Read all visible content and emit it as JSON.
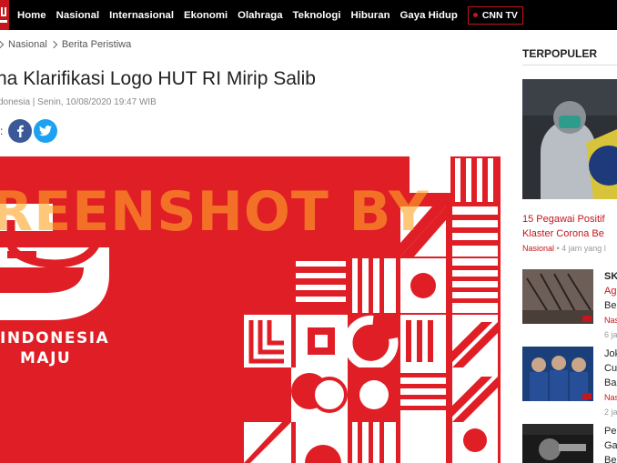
{
  "nav": {
    "items": [
      "Home",
      "Nasional",
      "Internasional",
      "Ekonomi",
      "Olahraga",
      "Teknologi",
      "Hiburan",
      "Gaya Hidup"
    ],
    "cnntv_label": "CNN TV"
  },
  "breadcrumb": {
    "items": [
      "Nasional",
      "Berita Peristiwa"
    ]
  },
  "article": {
    "title": "na Klarifikasi Logo HUT RI Mirip Salib",
    "meta": "donesia | Senin, 10/08/2020 19:47 WIB",
    "share_colon": ":",
    "hero_logo_text_line1": "INDONESIA",
    "hero_logo_text_line2": "MAJU",
    "watermark": "REENSHOT BY"
  },
  "sidebar": {
    "heading": "TERPOPULER",
    "top_story": {
      "title_line1": "15 Pegawai Positif",
      "title_line2": "Klaster Corona Be",
      "category": "Nasional",
      "time": " • 4 jam yang l"
    },
    "items": [
      {
        "title_line1": "SK",
        "title_line2": "Ag",
        "title_line3": "Be",
        "category": "Nas",
        "time": "6 ja"
      },
      {
        "title_line1": "Jok",
        "title_line2": "Cu",
        "title_line3": "Ba",
        "category": "Nas",
        "time": "2 ja"
      },
      {
        "title_line1": "Pe",
        "title_line2": "Ga",
        "title_line3": "Be",
        "category": "",
        "time": ""
      }
    ]
  },
  "colors": {
    "brand_red": "#c4161c",
    "hero_red": "#e01e25",
    "facebook": "#3b5998",
    "twitter": "#1da1f2"
  }
}
